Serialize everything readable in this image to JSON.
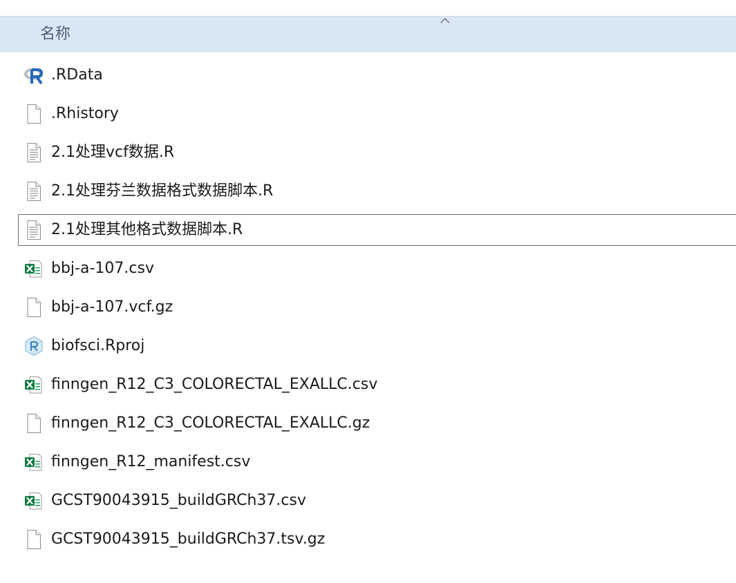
{
  "header": {
    "name_label": "名称",
    "sort_icon": "chevron-up-icon"
  },
  "files": [
    {
      "name": ".RData",
      "icon": "r-logo-icon",
      "selected": false
    },
    {
      "name": ".Rhistory",
      "icon": "blank-file-icon",
      "selected": false
    },
    {
      "name": "2.1处理vcf数据.R",
      "icon": "text-file-icon",
      "selected": false
    },
    {
      "name": "2.1处理芬兰数据格式数据脚本.R",
      "icon": "text-file-icon",
      "selected": false
    },
    {
      "name": "2.1处理其他格式数据脚本.R",
      "icon": "text-file-icon",
      "selected": true
    },
    {
      "name": "bbj-a-107.csv",
      "icon": "excel-file-icon",
      "selected": false
    },
    {
      "name": "bbj-a-107.vcf.gz",
      "icon": "blank-file-icon",
      "selected": false
    },
    {
      "name": "biofsci.Rproj",
      "icon": "rproj-icon",
      "selected": false
    },
    {
      "name": "finngen_R12_C3_COLORECTAL_EXALLC.csv",
      "icon": "excel-file-icon",
      "selected": false
    },
    {
      "name": "finngen_R12_C3_COLORECTAL_EXALLC.gz",
      "icon": "blank-file-icon",
      "selected": false
    },
    {
      "name": "finngen_R12_manifest.csv",
      "icon": "excel-file-icon",
      "selected": false
    },
    {
      "name": "GCST90043915_buildGRCh37.csv",
      "icon": "excel-file-icon",
      "selected": false
    },
    {
      "name": "GCST90043915_buildGRCh37.tsv.gz",
      "icon": "blank-file-icon",
      "selected": false
    }
  ]
}
